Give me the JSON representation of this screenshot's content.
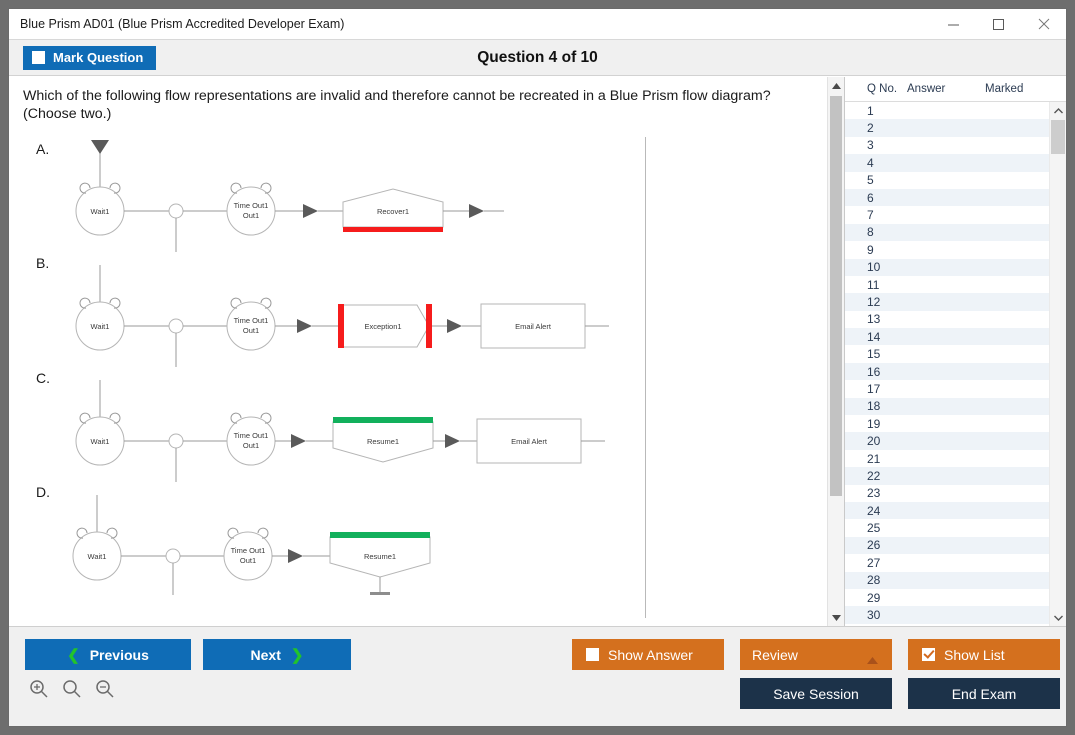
{
  "window": {
    "title": "Blue Prism AD01 (Blue Prism Accredited Developer Exam)",
    "controls": {
      "minimize": "minimize-icon",
      "maximize": "maximize-icon",
      "close": "close-icon"
    }
  },
  "header": {
    "mark_question_label": "Mark Question",
    "mark_question_checked": false,
    "question_title": "Question 4 of 10"
  },
  "question": {
    "text": "Which of the following flow representations are invalid and therefore cannot be recreated in a Blue Prism flow diagram? (Choose two.)",
    "options": [
      {
        "letter": "A.",
        "nodes": [
          "Wait1",
          "Time Out1",
          "Recover1"
        ],
        "accent": "#f61c1c",
        "accent_position": "bottom",
        "end_shape": "pentagon-up"
      },
      {
        "letter": "B.",
        "nodes": [
          "Wait1",
          "Time Out1",
          "Exception1",
          "Email Alert"
        ],
        "accent": "#f61c1c",
        "accent_position": "sides",
        "end_shape": "hexagon"
      },
      {
        "letter": "C.",
        "nodes": [
          "Wait1",
          "Time Out1",
          "Resume1",
          "Email Alert"
        ],
        "accent": "#12b05c",
        "accent_position": "top",
        "end_shape": "pentagon-down"
      },
      {
        "letter": "D.",
        "nodes": [
          "Wait1",
          "Time Out1",
          "Resume1"
        ],
        "accent": "#12b05c",
        "accent_position": "top",
        "end_shape": "pentagon-down-terminator"
      }
    ]
  },
  "question_list": {
    "columns": [
      "Q No.",
      "Answer",
      "Marked"
    ],
    "rows": [
      {
        "no": "1",
        "answer": "",
        "marked": ""
      },
      {
        "no": "2",
        "answer": "",
        "marked": ""
      },
      {
        "no": "3",
        "answer": "",
        "marked": ""
      },
      {
        "no": "4",
        "answer": "",
        "marked": ""
      },
      {
        "no": "5",
        "answer": "",
        "marked": ""
      },
      {
        "no": "6",
        "answer": "",
        "marked": ""
      },
      {
        "no": "7",
        "answer": "",
        "marked": ""
      },
      {
        "no": "8",
        "answer": "",
        "marked": ""
      },
      {
        "no": "9",
        "answer": "",
        "marked": ""
      },
      {
        "no": "10",
        "answer": "",
        "marked": ""
      },
      {
        "no": "11",
        "answer": "",
        "marked": ""
      },
      {
        "no": "12",
        "answer": "",
        "marked": ""
      },
      {
        "no": "13",
        "answer": "",
        "marked": ""
      },
      {
        "no": "14",
        "answer": "",
        "marked": ""
      },
      {
        "no": "15",
        "answer": "",
        "marked": ""
      },
      {
        "no": "16",
        "answer": "",
        "marked": ""
      },
      {
        "no": "17",
        "answer": "",
        "marked": ""
      },
      {
        "no": "18",
        "answer": "",
        "marked": ""
      },
      {
        "no": "19",
        "answer": "",
        "marked": ""
      },
      {
        "no": "20",
        "answer": "",
        "marked": ""
      },
      {
        "no": "21",
        "answer": "",
        "marked": ""
      },
      {
        "no": "22",
        "answer": "",
        "marked": ""
      },
      {
        "no": "23",
        "answer": "",
        "marked": ""
      },
      {
        "no": "24",
        "answer": "",
        "marked": ""
      },
      {
        "no": "25",
        "answer": "",
        "marked": ""
      },
      {
        "no": "26",
        "answer": "",
        "marked": ""
      },
      {
        "no": "27",
        "answer": "",
        "marked": ""
      },
      {
        "no": "28",
        "answer": "",
        "marked": ""
      },
      {
        "no": "29",
        "answer": "",
        "marked": ""
      },
      {
        "no": "30",
        "answer": "",
        "marked": ""
      }
    ]
  },
  "footer": {
    "previous_label": "Previous",
    "next_label": "Next",
    "show_answer_label": "Show Answer",
    "show_answer_checked": false,
    "review_label": "Review",
    "show_list_label": "Show List",
    "show_list_checked": true,
    "save_session_label": "Save Session",
    "end_exam_label": "End Exam",
    "zoom_in": "zoom-in-icon",
    "zoom_reset": "zoom-reset-icon",
    "zoom_out": "zoom-out-icon"
  },
  "colors": {
    "primary_blue": "#0f6cb6",
    "orange": "#d4701e",
    "navy": "#1c3249",
    "green_chevron": "#22c32b",
    "accent_red": "#f61c1c",
    "accent_green": "#12b05c"
  }
}
